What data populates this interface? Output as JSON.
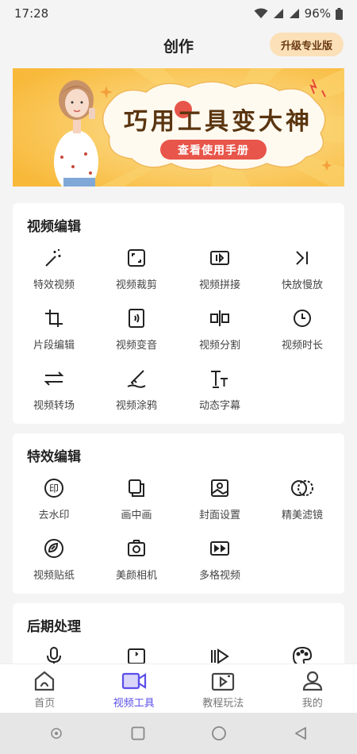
{
  "status_bar": {
    "time": "17:28",
    "battery": "96%"
  },
  "header": {
    "title": "创作",
    "upgrade_label": "升级专业版"
  },
  "banner": {
    "title": "巧用工具变大神",
    "button_label": "查看使用手册"
  },
  "sections": [
    {
      "title": "视频编辑",
      "tools": [
        {
          "label": "特效视频",
          "icon": "magic-wand-icon"
        },
        {
          "label": "视频裁剪",
          "icon": "crop-icon"
        },
        {
          "label": "视频拼接",
          "icon": "join-icon"
        },
        {
          "label": "快放慢放",
          "icon": "speed-icon"
        },
        {
          "label": "片段编辑",
          "icon": "clip-icon"
        },
        {
          "label": "视频变音",
          "icon": "voice-change-icon"
        },
        {
          "label": "视频分割",
          "icon": "split-icon"
        },
        {
          "label": "视频时长",
          "icon": "clock-icon"
        },
        {
          "label": "视频转场",
          "icon": "transition-icon"
        },
        {
          "label": "视频涂鸦",
          "icon": "brush-icon"
        },
        {
          "label": "动态字幕",
          "icon": "subtitle-icon"
        }
      ]
    },
    {
      "title": "特效编辑",
      "tools": [
        {
          "label": "去水印",
          "icon": "watermark-icon"
        },
        {
          "label": "画中画",
          "icon": "pip-icon"
        },
        {
          "label": "封面设置",
          "icon": "image-icon"
        },
        {
          "label": "精美滤镜",
          "icon": "filter-icon"
        },
        {
          "label": "视频贴纸",
          "icon": "sticker-icon"
        },
        {
          "label": "美颜相机",
          "icon": "camera-icon"
        },
        {
          "label": "多格视频",
          "icon": "grid-video-icon"
        }
      ]
    },
    {
      "title": "后期处理",
      "tools": [
        {
          "label": "",
          "icon": "microphone-icon"
        },
        {
          "label": "",
          "icon": "phone-frame-icon"
        },
        {
          "label": "",
          "icon": "play-bars-icon"
        },
        {
          "label": "",
          "icon": "palette-icon"
        }
      ]
    }
  ],
  "bottom_nav": [
    {
      "label": "首页",
      "icon": "home-icon",
      "active": false
    },
    {
      "label": "视频工具",
      "icon": "video-camera-icon",
      "active": true
    },
    {
      "label": "教程玩法",
      "icon": "tutorial-icon",
      "active": false
    },
    {
      "label": "我的",
      "icon": "profile-icon",
      "active": false
    }
  ],
  "colors": {
    "accent": "#5a4ee8",
    "upgrade_bg": "#fbe0b8",
    "banner_bg": "#fbc94a",
    "banner_button": "#e8554a"
  }
}
